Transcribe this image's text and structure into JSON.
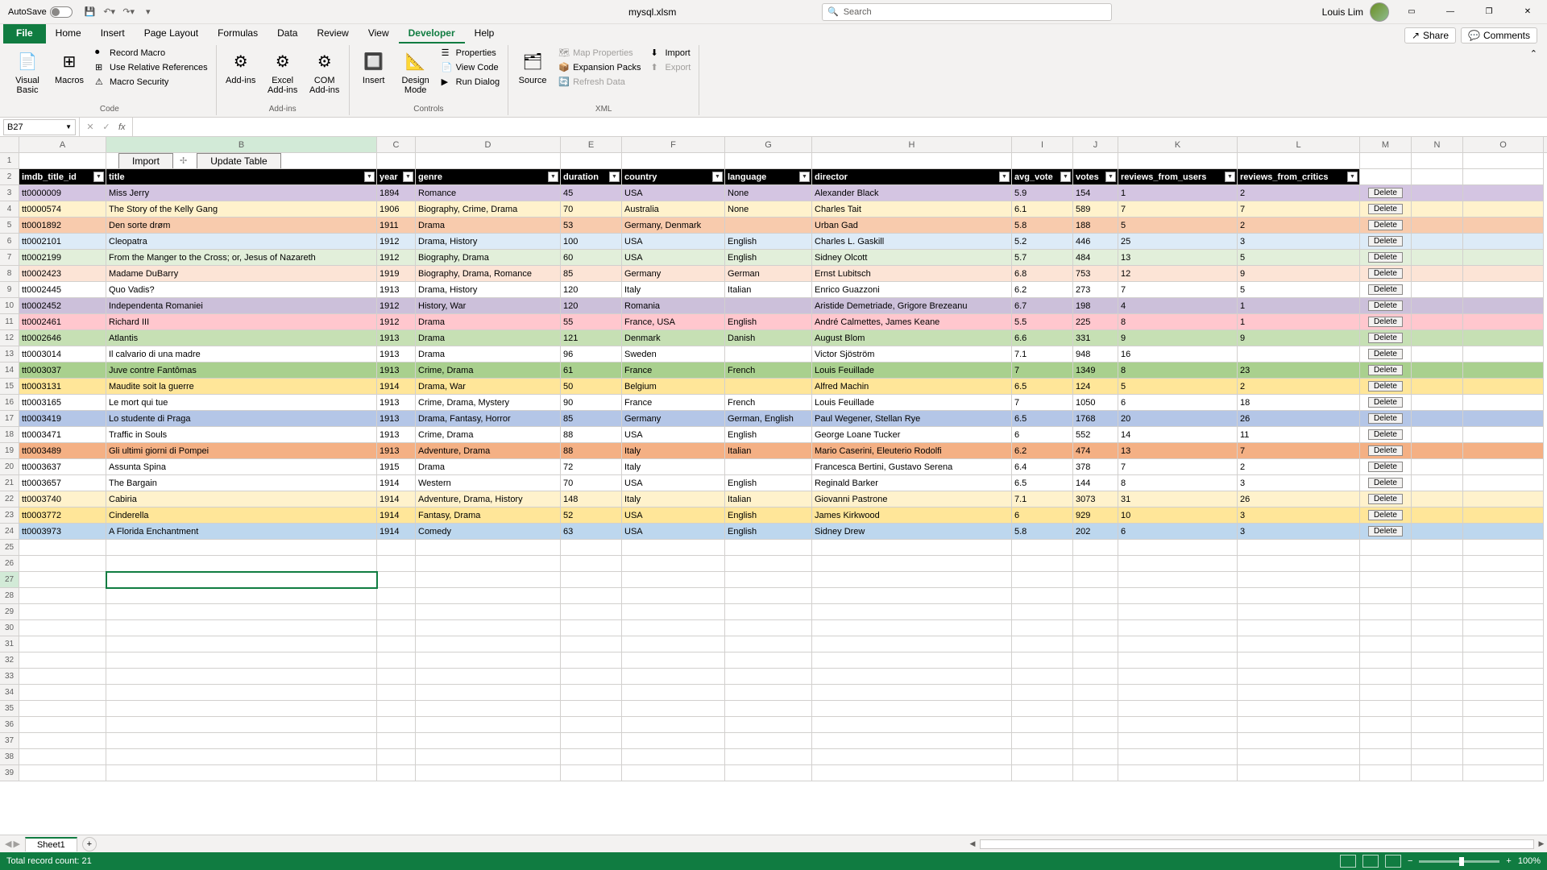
{
  "title_bar": {
    "autosave_label": "AutoSave",
    "autosave_state": "Off",
    "filename": "mysql.xlsm",
    "search_placeholder": "Search",
    "user": "Louis Lim"
  },
  "tabs": {
    "file": "File",
    "home": "Home",
    "insert": "Insert",
    "page_layout": "Page Layout",
    "formulas": "Formulas",
    "data": "Data",
    "review": "Review",
    "view": "View",
    "developer": "Developer",
    "help": "Help",
    "share": "Share",
    "comments": "Comments"
  },
  "ribbon": {
    "code": {
      "visual_basic": "Visual Basic",
      "macros": "Macros",
      "record": "Record Macro",
      "use_rel": "Use Relative References",
      "security": "Macro Security",
      "label": "Code"
    },
    "addins": {
      "addins": "Add-ins",
      "excel": "Excel Add-ins",
      "com": "COM Add-ins",
      "label": "Add-ins"
    },
    "controls": {
      "insert": "Insert",
      "design": "Design Mode",
      "props": "Properties",
      "view_code": "View Code",
      "run": "Run Dialog",
      "label": "Controls"
    },
    "xml": {
      "source": "Source",
      "map_props": "Map Properties",
      "expansion": "Expansion Packs",
      "refresh": "Refresh Data",
      "import": "Import",
      "export": "Export",
      "label": "XML"
    }
  },
  "name_box": "B27",
  "sheet_buttons": {
    "import": "Import",
    "update": "Update Table"
  },
  "columns": [
    "A",
    "B",
    "C",
    "D",
    "E",
    "F",
    "G",
    "H",
    "I",
    "J",
    "K",
    "L",
    "M",
    "N",
    "O"
  ],
  "headers": {
    "imdb_title_id": "imdb_title_id",
    "title": "title",
    "year": "year",
    "genre": "genre",
    "duration": "duration",
    "country": "country",
    "language": "language",
    "director": "director",
    "avg_vote": "avg_vote",
    "votes": "votes",
    "reviews_from_users": "reviews_from_users",
    "reviews_from_critics": "reviews_from_critics"
  },
  "delete_label": "Delete",
  "rows": [
    {
      "id": "tt0000009",
      "title": "Miss Jerry",
      "year": "1894",
      "genre": "Romance",
      "duration": "45",
      "country": "USA",
      "language": "None",
      "director": "Alexander Black",
      "avg_vote": "5.9",
      "votes": "154",
      "rfu": "1",
      "rfc": "2",
      "color": 0
    },
    {
      "id": "tt0000574",
      "title": "The Story of the Kelly Gang",
      "year": "1906",
      "genre": "Biography, Crime, Drama",
      "duration": "70",
      "country": "Australia",
      "language": "None",
      "director": "Charles Tait",
      "avg_vote": "6.1",
      "votes": "589",
      "rfu": "7",
      "rfc": "7",
      "color": 1
    },
    {
      "id": "tt0001892",
      "title": "Den sorte drøm",
      "year": "1911",
      "genre": "Drama",
      "duration": "53",
      "country": "Germany, Denmark",
      "language": "",
      "director": "Urban Gad",
      "avg_vote": "5.8",
      "votes": "188",
      "rfu": "5",
      "rfc": "2",
      "color": 2
    },
    {
      "id": "tt0002101",
      "title": "Cleopatra",
      "year": "1912",
      "genre": "Drama, History",
      "duration": "100",
      "country": "USA",
      "language": "English",
      "director": "Charles L. Gaskill",
      "avg_vote": "5.2",
      "votes": "446",
      "rfu": "25",
      "rfc": "3",
      "color": 3
    },
    {
      "id": "tt0002199",
      "title": "From the Manger to the Cross; or, Jesus of Nazareth",
      "year": "1912",
      "genre": "Biography, Drama",
      "duration": "60",
      "country": "USA",
      "language": "English",
      "director": "Sidney Olcott",
      "avg_vote": "5.7",
      "votes": "484",
      "rfu": "13",
      "rfc": "5",
      "color": 4
    },
    {
      "id": "tt0002423",
      "title": "Madame DuBarry",
      "year": "1919",
      "genre": "Biography, Drama, Romance",
      "duration": "85",
      "country": "Germany",
      "language": "German",
      "director": "Ernst Lubitsch",
      "avg_vote": "6.8",
      "votes": "753",
      "rfu": "12",
      "rfc": "9",
      "color": 5
    },
    {
      "id": "tt0002445",
      "title": "Quo Vadis?",
      "year": "1913",
      "genre": "Drama, History",
      "duration": "120",
      "country": "Italy",
      "language": "Italian",
      "director": "Enrico Guazzoni",
      "avg_vote": "6.2",
      "votes": "273",
      "rfu": "7",
      "rfc": "5",
      "color": 6
    },
    {
      "id": "tt0002452",
      "title": "Independenta Romaniei",
      "year": "1912",
      "genre": "History, War",
      "duration": "120",
      "country": "Romania",
      "language": "",
      "director": "Aristide Demetriade, Grigore Brezeanu",
      "avg_vote": "6.7",
      "votes": "198",
      "rfu": "4",
      "rfc": "1",
      "color": 7
    },
    {
      "id": "tt0002461",
      "title": "Richard III",
      "year": "1912",
      "genre": "Drama",
      "duration": "55",
      "country": "France, USA",
      "language": "English",
      "director": "André Calmettes, James Keane",
      "avg_vote": "5.5",
      "votes": "225",
      "rfu": "8",
      "rfc": "1",
      "color": 8
    },
    {
      "id": "tt0002646",
      "title": "Atlantis",
      "year": "1913",
      "genre": "Drama",
      "duration": "121",
      "country": "Denmark",
      "language": "Danish",
      "director": "August Blom",
      "avg_vote": "6.6",
      "votes": "331",
      "rfu": "9",
      "rfc": "9",
      "color": 9
    },
    {
      "id": "tt0003014",
      "title": "Il calvario di una madre",
      "year": "1913",
      "genre": "Drama",
      "duration": "96",
      "country": "Sweden",
      "language": "",
      "director": "Victor Sjöström",
      "avg_vote": "7.1",
      "votes": "948",
      "rfu": "16",
      "rfc": "",
      "color": 12
    },
    {
      "id": "tt0003037",
      "title": "Juve contre Fantômas",
      "year": "1913",
      "genre": "Crime, Drama",
      "duration": "61",
      "country": "France",
      "language": "French",
      "director": "Louis Feuillade",
      "avg_vote": "7",
      "votes": "1349",
      "rfu": "8",
      "rfc": "23",
      "color": 13
    },
    {
      "id": "tt0003131",
      "title": "Maudite soit la guerre",
      "year": "1914",
      "genre": "Drama, War",
      "duration": "50",
      "country": "Belgium",
      "language": "",
      "director": "Alfred Machin",
      "avg_vote": "6.5",
      "votes": "124",
      "rfu": "5",
      "rfc": "2",
      "color": 14
    },
    {
      "id": "tt0003165",
      "title": "Le mort qui tue",
      "year": "1913",
      "genre": "Crime, Drama, Mystery",
      "duration": "90",
      "country": "France",
      "language": "French",
      "director": "Louis Feuillade",
      "avg_vote": "7",
      "votes": "1050",
      "rfu": "6",
      "rfc": "18",
      "color": 15
    },
    {
      "id": "tt0003419",
      "title": "Lo studente di Praga",
      "year": "1913",
      "genre": "Drama, Fantasy, Horror",
      "duration": "85",
      "country": "Germany",
      "language": "German, English",
      "director": "Paul Wegener, Stellan Rye",
      "avg_vote": "6.5",
      "votes": "1768",
      "rfu": "20",
      "rfc": "26",
      "color": 16
    },
    {
      "id": "tt0003471",
      "title": "Traffic in Souls",
      "year": "1913",
      "genre": "Crime, Drama",
      "duration": "88",
      "country": "USA",
      "language": "English",
      "director": "George Loane Tucker",
      "avg_vote": "6",
      "votes": "552",
      "rfu": "14",
      "rfc": "11",
      "color": 17
    },
    {
      "id": "tt0003489",
      "title": "Gli ultimi giorni di Pompei",
      "year": "1913",
      "genre": "Adventure, Drama",
      "duration": "88",
      "country": "Italy",
      "language": "Italian",
      "director": "Mario Caserini, Eleuterio Rodolfi",
      "avg_vote": "6.2",
      "votes": "474",
      "rfu": "13",
      "rfc": "7",
      "color": 18
    },
    {
      "id": "tt0003637",
      "title": "Assunta Spina",
      "year": "1915",
      "genre": "Drama",
      "duration": "72",
      "country": "Italy",
      "language": "",
      "director": "Francesca Bertini, Gustavo Serena",
      "avg_vote": "6.4",
      "votes": "378",
      "rfu": "7",
      "rfc": "2",
      "color": 19
    },
    {
      "id": "tt0003657",
      "title": "The Bargain",
      "year": "1914",
      "genre": "Western",
      "duration": "70",
      "country": "USA",
      "language": "English",
      "director": "Reginald Barker",
      "avg_vote": "6.5",
      "votes": "144",
      "rfu": "8",
      "rfc": "3",
      "color": 20
    },
    {
      "id": "tt0003740",
      "title": "Cabiria",
      "year": "1914",
      "genre": "Adventure, Drama, History",
      "duration": "148",
      "country": "Italy",
      "language": "Italian",
      "director": "Giovanni Pastrone",
      "avg_vote": "7.1",
      "votes": "3073",
      "rfu": "31",
      "rfc": "26",
      "color": 21
    },
    {
      "id": "tt0003772",
      "title": "Cinderella",
      "year": "1914",
      "genre": "Fantasy, Drama",
      "duration": "52",
      "country": "USA",
      "language": "English",
      "director": "James Kirkwood",
      "avg_vote": "6",
      "votes": "929",
      "rfu": "10",
      "rfc": "3",
      "color": 22
    },
    {
      "id": "tt0003973",
      "title": "A Florida Enchantment",
      "year": "1914",
      "genre": "Comedy",
      "duration": "63",
      "country": "USA",
      "language": "English",
      "director": "Sidney Drew",
      "avg_vote": "5.8",
      "votes": "202",
      "rfu": "6",
      "rfc": "3",
      "color": 23
    }
  ],
  "sheet_tab": "Sheet1",
  "status": {
    "text": "Total record count: 21",
    "zoom": "100%"
  }
}
